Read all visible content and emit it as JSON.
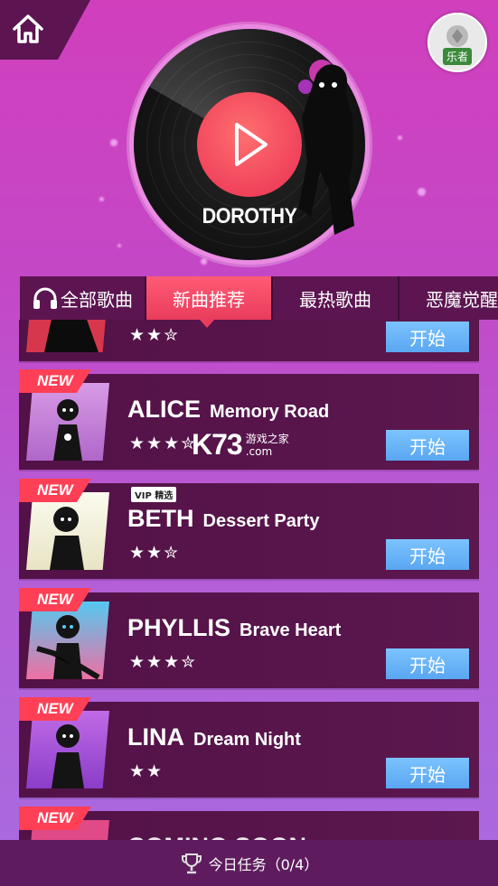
{
  "header": {
    "home_icon": "home-icon",
    "avatar_label": "乐者"
  },
  "player": {
    "current_song": "DOROTHY",
    "play_icon": "play-icon"
  },
  "tabs": [
    {
      "label": "全部歌曲",
      "icon": "headphones-icon",
      "active": false
    },
    {
      "label": "新曲推荐",
      "active": true
    },
    {
      "label": "最热歌曲",
      "active": false
    },
    {
      "label": "恶魔觉醒",
      "active": false
    }
  ],
  "songs": [
    {
      "artist": "",
      "title": "",
      "stars": "★★✮",
      "new": false,
      "start_label": "开始"
    },
    {
      "artist": "ALICE",
      "title": "Memory Road",
      "stars": "★★★✮",
      "new": true,
      "new_label": "NEW",
      "start_label": "开始"
    },
    {
      "artist": "BETH",
      "title": "Dessert Party",
      "stars": "★★✮",
      "new": true,
      "new_label": "NEW",
      "vip_label": "VIP 精选",
      "start_label": "开始"
    },
    {
      "artist": "PHYLLIS",
      "title": "Brave Heart",
      "stars": "★★★✮",
      "new": true,
      "new_label": "NEW",
      "start_label": "开始"
    },
    {
      "artist": "LINA",
      "title": "Dream Night",
      "stars": "★★",
      "new": true,
      "new_label": "NEW",
      "start_label": "开始"
    },
    {
      "artist": "COMING SOON",
      "title": "",
      "stars": "",
      "new": true,
      "new_label": "NEW",
      "start_label": ""
    }
  ],
  "watermark": {
    "big": "K73",
    "line1": "游戏之家",
    "line2": ".com"
  },
  "bottom": {
    "icon": "trophy-icon",
    "label": "今日任务（0/4）"
  },
  "colors": {
    "accent": "#ff3f55",
    "start_button": "#5aa6f1",
    "card_bg": "#531247",
    "tab_bar": "#5c1550"
  }
}
